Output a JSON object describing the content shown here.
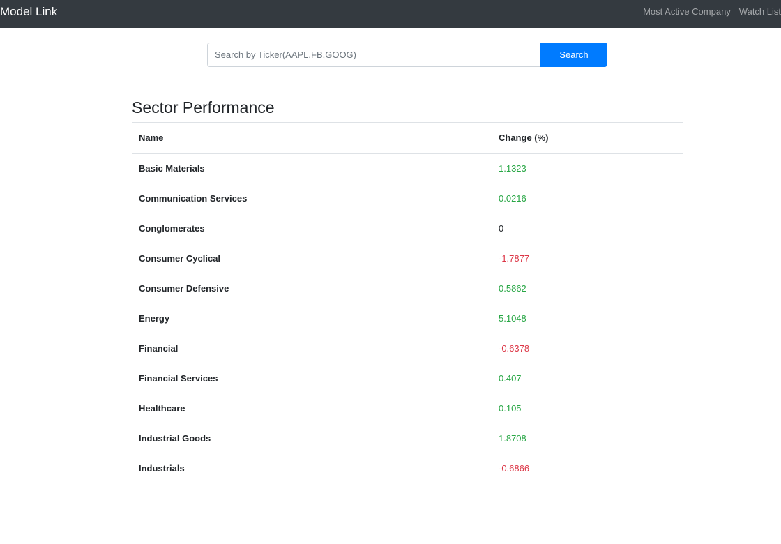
{
  "navbar": {
    "brand": "Model Link",
    "links": [
      "Most Active Company",
      "Watch List"
    ],
    "background": "#343a40"
  },
  "search": {
    "placeholder": "Search by Ticker(AAPL,FB,GOOG)",
    "value": "",
    "button_label": "Search",
    "button_color": "#007bff"
  },
  "section": {
    "title": "Sector Performance"
  },
  "table": {
    "headers": [
      "Name",
      "Change (%)"
    ],
    "rows": [
      {
        "name": "Basic Materials",
        "change": "1.1323",
        "trend": "positive"
      },
      {
        "name": "Communication Services",
        "change": "0.0216",
        "trend": "positive"
      },
      {
        "name": "Conglomerates",
        "change": "0",
        "trend": "zero"
      },
      {
        "name": "Consumer Cyclical",
        "change": "-1.7877",
        "trend": "negative"
      },
      {
        "name": "Consumer Defensive",
        "change": "0.5862",
        "trend": "positive"
      },
      {
        "name": "Energy",
        "change": "5.1048",
        "trend": "positive"
      },
      {
        "name": "Financial",
        "change": "-0.6378",
        "trend": "negative"
      },
      {
        "name": "Financial Services",
        "change": "0.407",
        "trend": "positive"
      },
      {
        "name": "Healthcare",
        "change": "0.105",
        "trend": "positive"
      },
      {
        "name": "Industrial Goods",
        "change": "1.8708",
        "trend": "positive"
      },
      {
        "name": "Industrials",
        "change": "-0.6866",
        "trend": "negative"
      }
    ],
    "colors": {
      "positive": "#28a745",
      "negative": "#dc3545",
      "zero": "#212529"
    }
  }
}
